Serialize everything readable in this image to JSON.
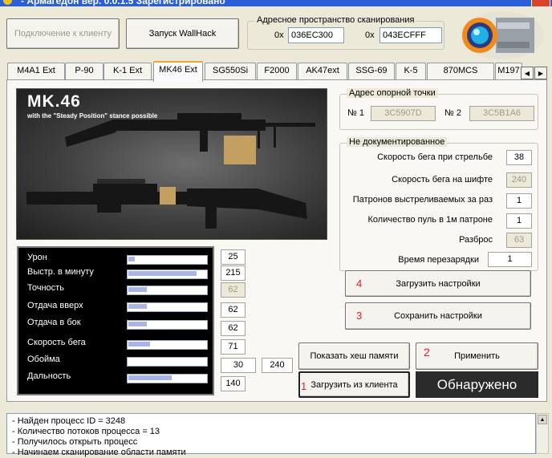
{
  "window": {
    "title": "- Армагедон вер. 0.0.1.5  Зарегистрировано"
  },
  "toolbar": {
    "connect_label": "Подключение к клиенту",
    "wallhack_label": "Запуск WallHack"
  },
  "scan": {
    "title": "Адресное пространство сканирования",
    "prefix1": "0x",
    "start": "036EC300",
    "prefix2": "0x",
    "end": "043ECFFF"
  },
  "tabs": [
    "M4A1 Ext",
    "P-90",
    "K-1 Ext",
    "MK46 Ext",
    "SG550Si",
    "F2000",
    "AK47ext",
    "SSG-69",
    "K-5",
    "870MCS",
    "M197"
  ],
  "active_tab": "MK46 Ext",
  "weapon": {
    "name": "MK.46",
    "subtitle": "with the \"Steady Position\" stance possible"
  },
  "ref_address": {
    "title": "Адрес опорной точки",
    "label1": "№ 1",
    "value1": "3C5907D",
    "label2": "№ 2",
    "value2": "3C5B1A6"
  },
  "undocumented": {
    "title": "Не документированное",
    "rows": [
      {
        "label": "Скорость бега при стрельбе",
        "value": "38"
      },
      {
        "label": "Скорость бега на шифте",
        "value": "240"
      },
      {
        "label": "Патронов выстреливаемых за раз",
        "value": "1"
      },
      {
        "label": "Количество пуль в 1м патроне",
        "value": "1"
      },
      {
        "label": "Разброс",
        "value": "63"
      },
      {
        "label": "Время перезарядки",
        "value": "1"
      }
    ]
  },
  "stats": [
    {
      "label": "Урон",
      "value": "25",
      "level": 0.08
    },
    {
      "label": "Выстр. в минуту",
      "value": "215",
      "level": 0.88
    },
    {
      "label": "Точность",
      "value": "62",
      "level": 0.24
    },
    {
      "label": "Отдача вверх",
      "value": "62",
      "level": 0.24
    },
    {
      "label": "Отдача в бок",
      "value": "62",
      "level": 0.24
    },
    {
      "label": "Скорость бега",
      "value": "71",
      "level": 0.28
    },
    {
      "label": "Обойма",
      "value": "30",
      "value2": "240",
      "level": 0
    },
    {
      "label": "Дальность",
      "value": "140",
      "level": 0.56
    }
  ],
  "actions": {
    "load_settings": "Загрузить настройки",
    "load_num": "4",
    "save_settings": "Сохранить настройки",
    "save_num": "3",
    "hash_label": "Показать хеш памяти",
    "apply_label": "Применить",
    "apply_num": "2",
    "load_client": "Загрузить из клиента",
    "load_client_num": "1",
    "status": "Обнаружено"
  },
  "log": [
    "- Найден процесс ID = 3248",
    "- Количество потоков процесса = 13",
    "- Получилось открыть процесс",
    "- Начинаем сканирование области памяти"
  ],
  "colors": {
    "accent_numbers": "#e0202a",
    "status_bg": "#2b2b2b",
    "titlebar": "#2a5fd8",
    "tab_highlight": "#f0a630"
  }
}
